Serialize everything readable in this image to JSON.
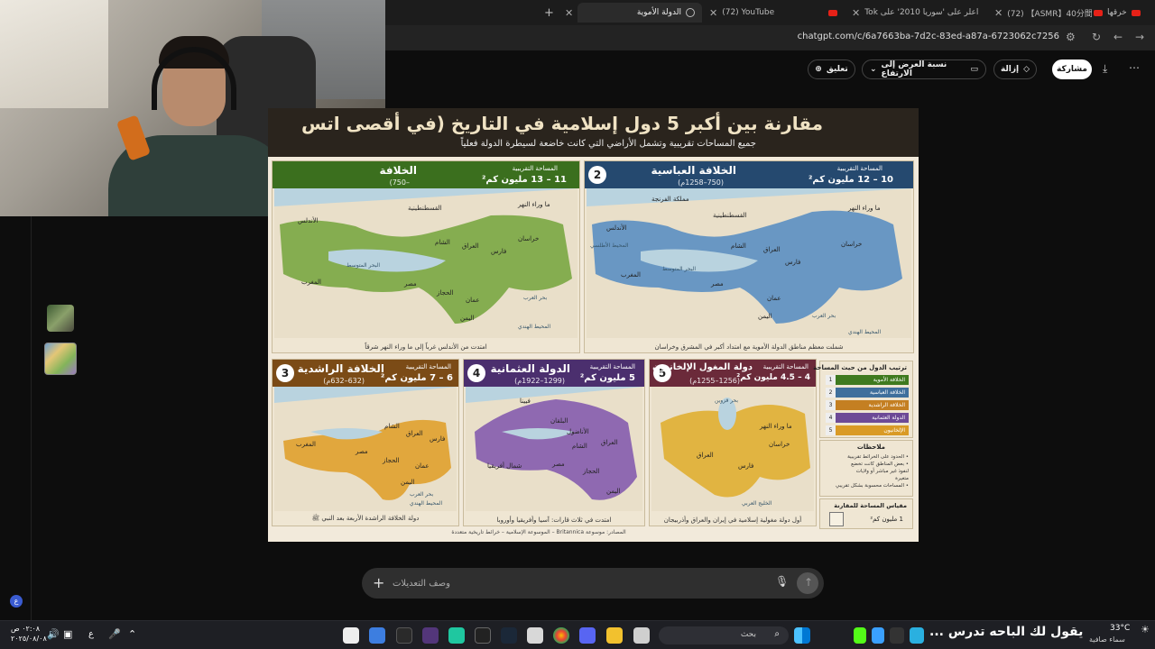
{
  "browser": {
    "tabs": [
      {
        "title": "الدولة الأموية",
        "active": true
      },
      {
        "title": "(72) YouTube"
      },
      {
        "title": "اعلر على 'سوريا 2010' على Tok"
      },
      {
        "title": "(72) 【ASMR】40分間耐ら"
      },
      {
        "title": "خرقها"
      }
    ],
    "url": "chatgpt.com/c/6a7663ba-7d2c-83ed-a87a-6723062c7256"
  },
  "chat_header": {
    "comment_label": "تعليق",
    "aspect_label": "نسبة العرض إلى الارتفاع",
    "remove_label": "إزالة",
    "share_label": "مشاركة"
  },
  "infographic": {
    "title": "مقارنة بين أكبر 5 دول إسلامية في التاريخ (في أقصى اتس",
    "subtitle": "جميع المساحات تقريبية وتشمل الأراضي التي كانت خاضعة لسيطرة الدولة فعلياً",
    "area_label": "المساحة التقريبية",
    "cards": [
      {
        "rank": "1",
        "name": "الخلافة",
        "dates": "–750)",
        "area": "11 – 13 مليون كم²",
        "caption": "امتدت من الأندلس غرباً إلى ما وراء النهر شرقاً",
        "color": "#3f7a1f",
        "map_color": "#7aa743"
      },
      {
        "rank": "2",
        "name": "الخلافة العباسية",
        "dates": "(750–1258م)",
        "area": "10 – 12 مليون كم²",
        "caption": "شملت معظم مناطق الدولة الأموية مع امتداد أكبر في المشرق وخراسان",
        "color": "#25496f",
        "map_color": "#5b8fc2"
      },
      {
        "rank": "3",
        "name": "الخلافة الراشدية",
        "dates": "(632–632م)",
        "area": "6 – 7 مليون كم²",
        "caption": "دولة الخلافة الراشدة الأربعة بعد النبي ﷺ",
        "color": "#7b4b16",
        "map_color": "#e0a336"
      },
      {
        "rank": "4",
        "name": "الدولة العثمانية",
        "dates": "(1299–1922م)",
        "area": "5 مليون كم²",
        "caption": "امتدت في ثلاث قارات: آسيا وأفريقيا وأوروبا",
        "color": "#4b2f6e",
        "map_color": "#8a62b0"
      },
      {
        "rank": "5",
        "name": "دولة المغول الإلخانيون",
        "dates": "(1256–1255م)",
        "area": "4 – 4.5 مليون كم²",
        "caption": "أول دولة مغولية إسلامية في إيران والعراق وأذربيجان",
        "color": "#6b2a3a",
        "map_color": "#e0b13a"
      }
    ],
    "map_labels": {
      "card1": [
        "ما وراء النهر",
        "القسطنطينية",
        "الأندلس",
        "البحر المتوسط",
        "الشام",
        "العراق",
        "خراسان",
        "فارس",
        "المغرب",
        "مصر",
        "الحجاز",
        "عمان",
        "اليمن",
        "بحر العرب",
        "المحيط الهندي"
      ],
      "card2": [
        "مملكة الفرنجة",
        "ما وراء النهر",
        "القسطنطينية",
        "الأندلس",
        "البحر المتوسط",
        "الشام",
        "العراق",
        "خراسان",
        "فارس",
        "المغرب",
        "مصر",
        "عمان",
        "اليمن",
        "بحر العرب",
        "المحيط الهندي",
        "المحيط الأطلسي"
      ],
      "card3": [
        "الشام",
        "العراق",
        "فارس",
        "المغرب",
        "مصر",
        "الحجاز",
        "عمان",
        "اليمن",
        "بحر العرب",
        "المحيط الهندي"
      ],
      "card4": [
        "فيينا",
        "البلقان",
        "الأناضول",
        "الشام",
        "العراق",
        "مصر",
        "شمال أفريقيا",
        "الحجاز",
        "اليمن"
      ],
      "card5": [
        "بحر قزوين",
        "ما وراء النهر",
        "خراسان",
        "العراق",
        "فارس",
        "الخليج العربي"
      ]
    },
    "ranking": {
      "title": "ترتيب الدول من حيث المساحة",
      "items": [
        {
          "rank": "1",
          "label": "الخلافة الأموية",
          "color": "#3f7a1f"
        },
        {
          "rank": "2",
          "label": "الخلافة العباسية",
          "color": "#3f6f9c"
        },
        {
          "rank": "3",
          "label": "الخلافة الراشدية",
          "color": "#c47f22"
        },
        {
          "rank": "4",
          "label": "الدولة العثمانية",
          "color": "#6d4a96"
        },
        {
          "rank": "5",
          "label": "الإلخانيون",
          "color": "#d99a25"
        }
      ]
    },
    "notes": {
      "title": "ملاحظات",
      "lines": [
        "• الحدود على الخرائط تقريبية",
        "• بعض المناطق كانت تخضع",
        "لنفوذ غير مباشر أو ولايات",
        "متغيرة",
        "• المساحات محسوبة بشكل تقريبي"
      ]
    },
    "scale": {
      "title": "مقياس المساحة للمقارنة",
      "value": "1 مليون كم²"
    },
    "sources": "المصادر: موسوعة Britannica – الموسوعة الإسلامية – خرائط تاريخية متعددة"
  },
  "composer": {
    "placeholder": "وصف التعديلات"
  },
  "taskbar": {
    "search_label": "بحث",
    "ticker": "يقول لك الباحه تدرس ...",
    "weather_temp": "33°C",
    "weather_desc": "سماء صافية",
    "time": "٠٢:٠٨ ص",
    "date": "٢٠٢٥/٠٨/٠٨",
    "lang": "ع",
    "notification_count": "ع"
  }
}
